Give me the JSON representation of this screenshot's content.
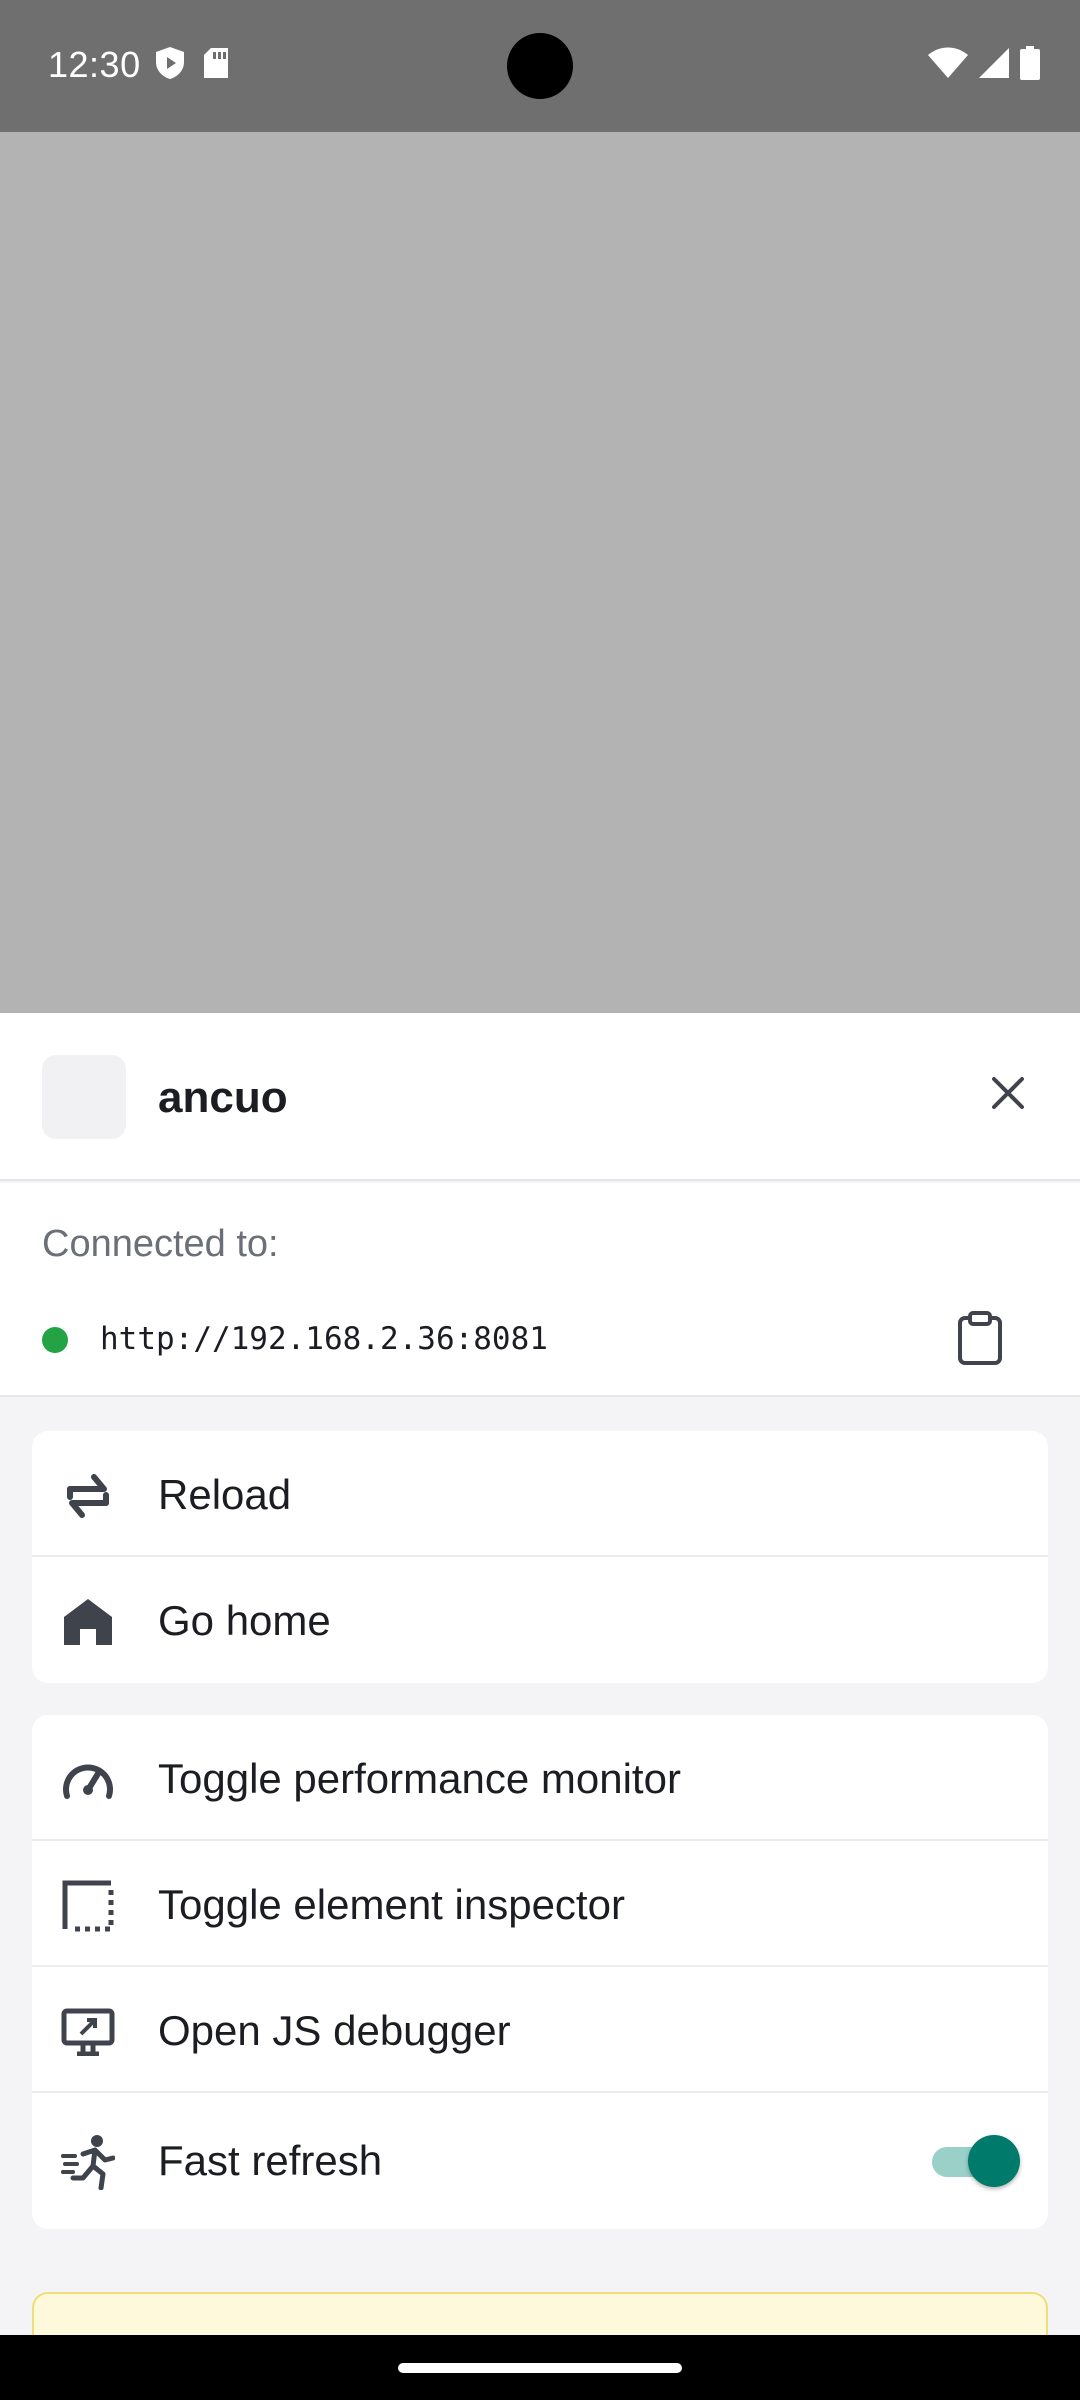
{
  "status_bar": {
    "time": "12:30",
    "left_icons": [
      "shield-icon",
      "sd-card-icon"
    ],
    "right_icons": [
      "wifi-icon",
      "signal-icon",
      "battery-icon"
    ]
  },
  "sheet": {
    "app_name": "ancuo",
    "connection": {
      "label": "Connected to:",
      "url": "http://192.168.2.36:8081",
      "status_color": "#23a344"
    },
    "menu_group_1": [
      {
        "label": "Reload",
        "icon": "reload-icon"
      },
      {
        "label": "Go home",
        "icon": "home-icon"
      }
    ],
    "menu_group_2": [
      {
        "label": "Toggle performance monitor",
        "icon": "speedometer-icon"
      },
      {
        "label": "Toggle element inspector",
        "icon": "inspector-icon"
      },
      {
        "label": "Open JS debugger",
        "icon": "debugger-icon"
      },
      {
        "label": "Fast refresh",
        "icon": "running-icon",
        "toggle_on": true
      }
    ]
  },
  "colors": {
    "accent": "#007a6b",
    "accent_track": "#9ad0c8",
    "status_green": "#23a344"
  }
}
